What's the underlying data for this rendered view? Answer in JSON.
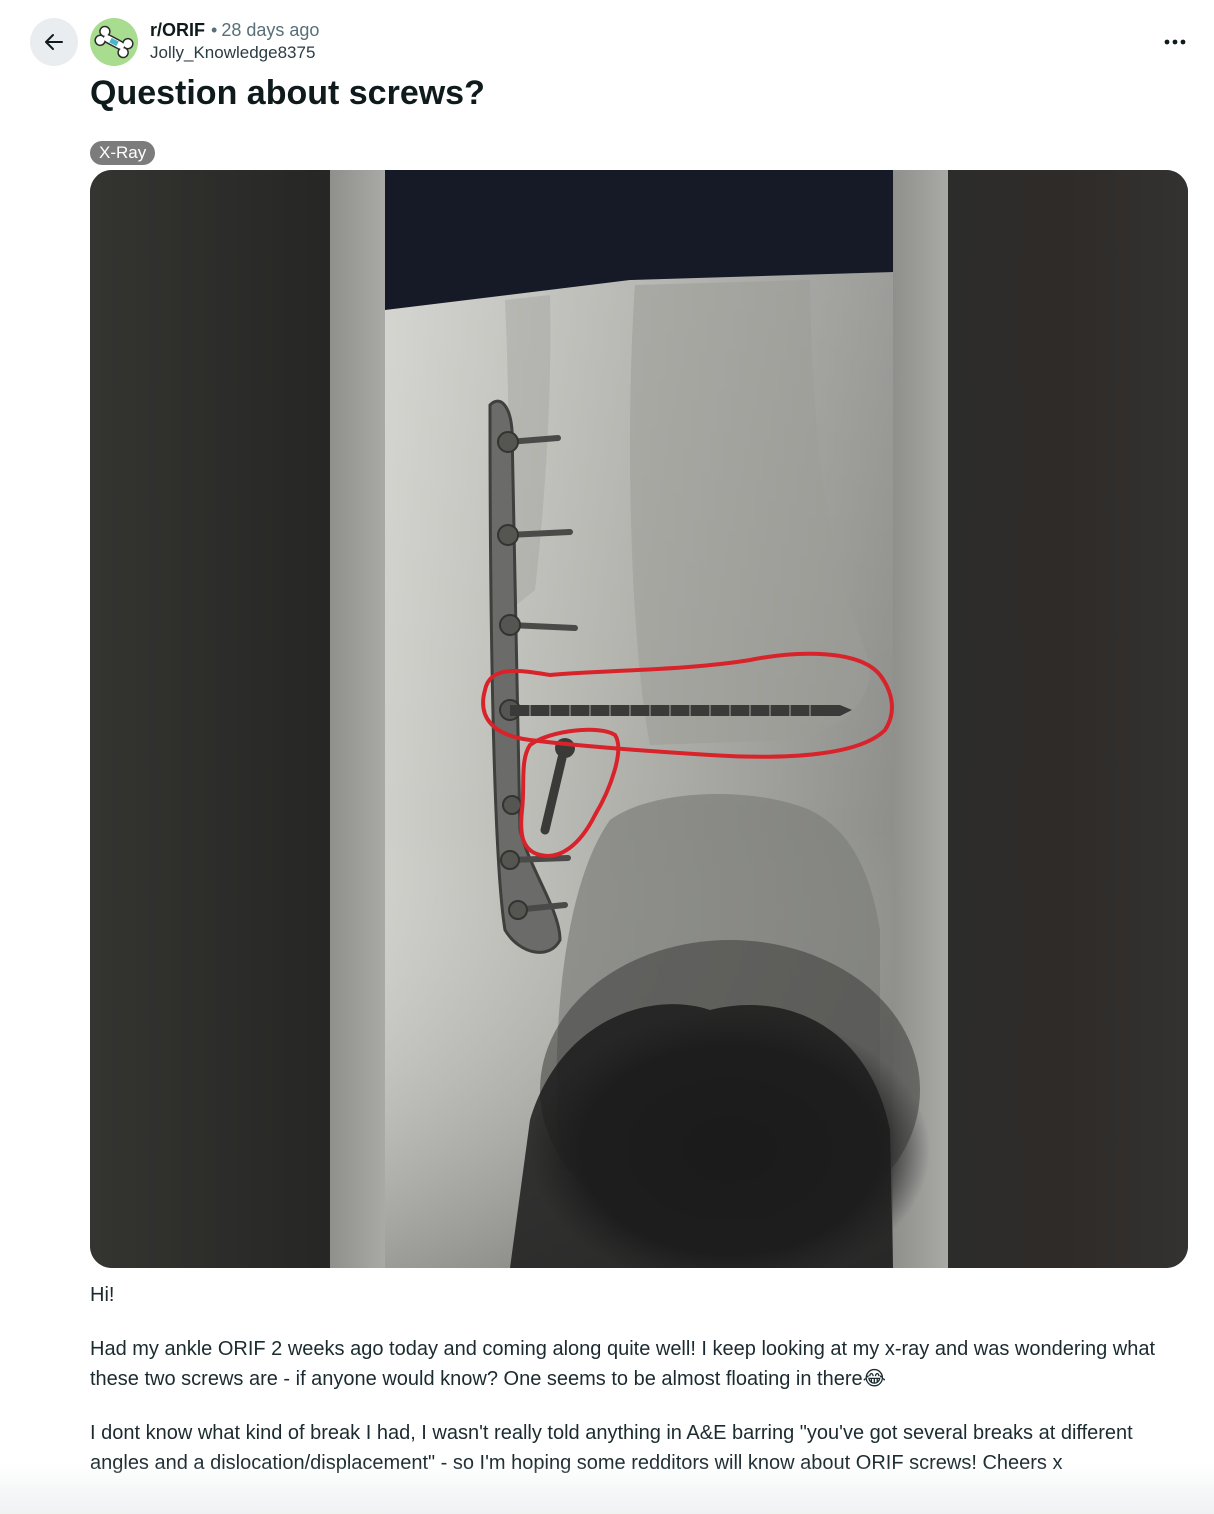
{
  "header": {
    "subreddit": "r/ORIF",
    "separator": "•",
    "time_ago": "28 days ago",
    "username": "Jolly_Knowledge8375"
  },
  "post": {
    "title": "Question about screws?",
    "flair": "X-Ray",
    "paragraphs": [
      "Hi!",
      "Had my ankle ORIF 2 weeks ago today and coming along quite well! I keep looking at my x-ray and was wondering what these two screws are - if anyone would know? One seems to be almost floating in there😂",
      "I dont know what kind of break I had, I wasn't really told anything in A&E barring \"you've got several breaks at different angles and a dislocation/displacement\" - so I'm hoping some redditors will know about ORIF screws! Cheers x"
    ]
  },
  "icons": {
    "back": "arrow-left-icon",
    "avatar": "bone-icon",
    "more": "more-horizontal-icon"
  },
  "colors": {
    "flair_bg": "#7c7c7c",
    "annotation_red": "#d8232a",
    "avatar_bg": "#a8dc8e"
  }
}
